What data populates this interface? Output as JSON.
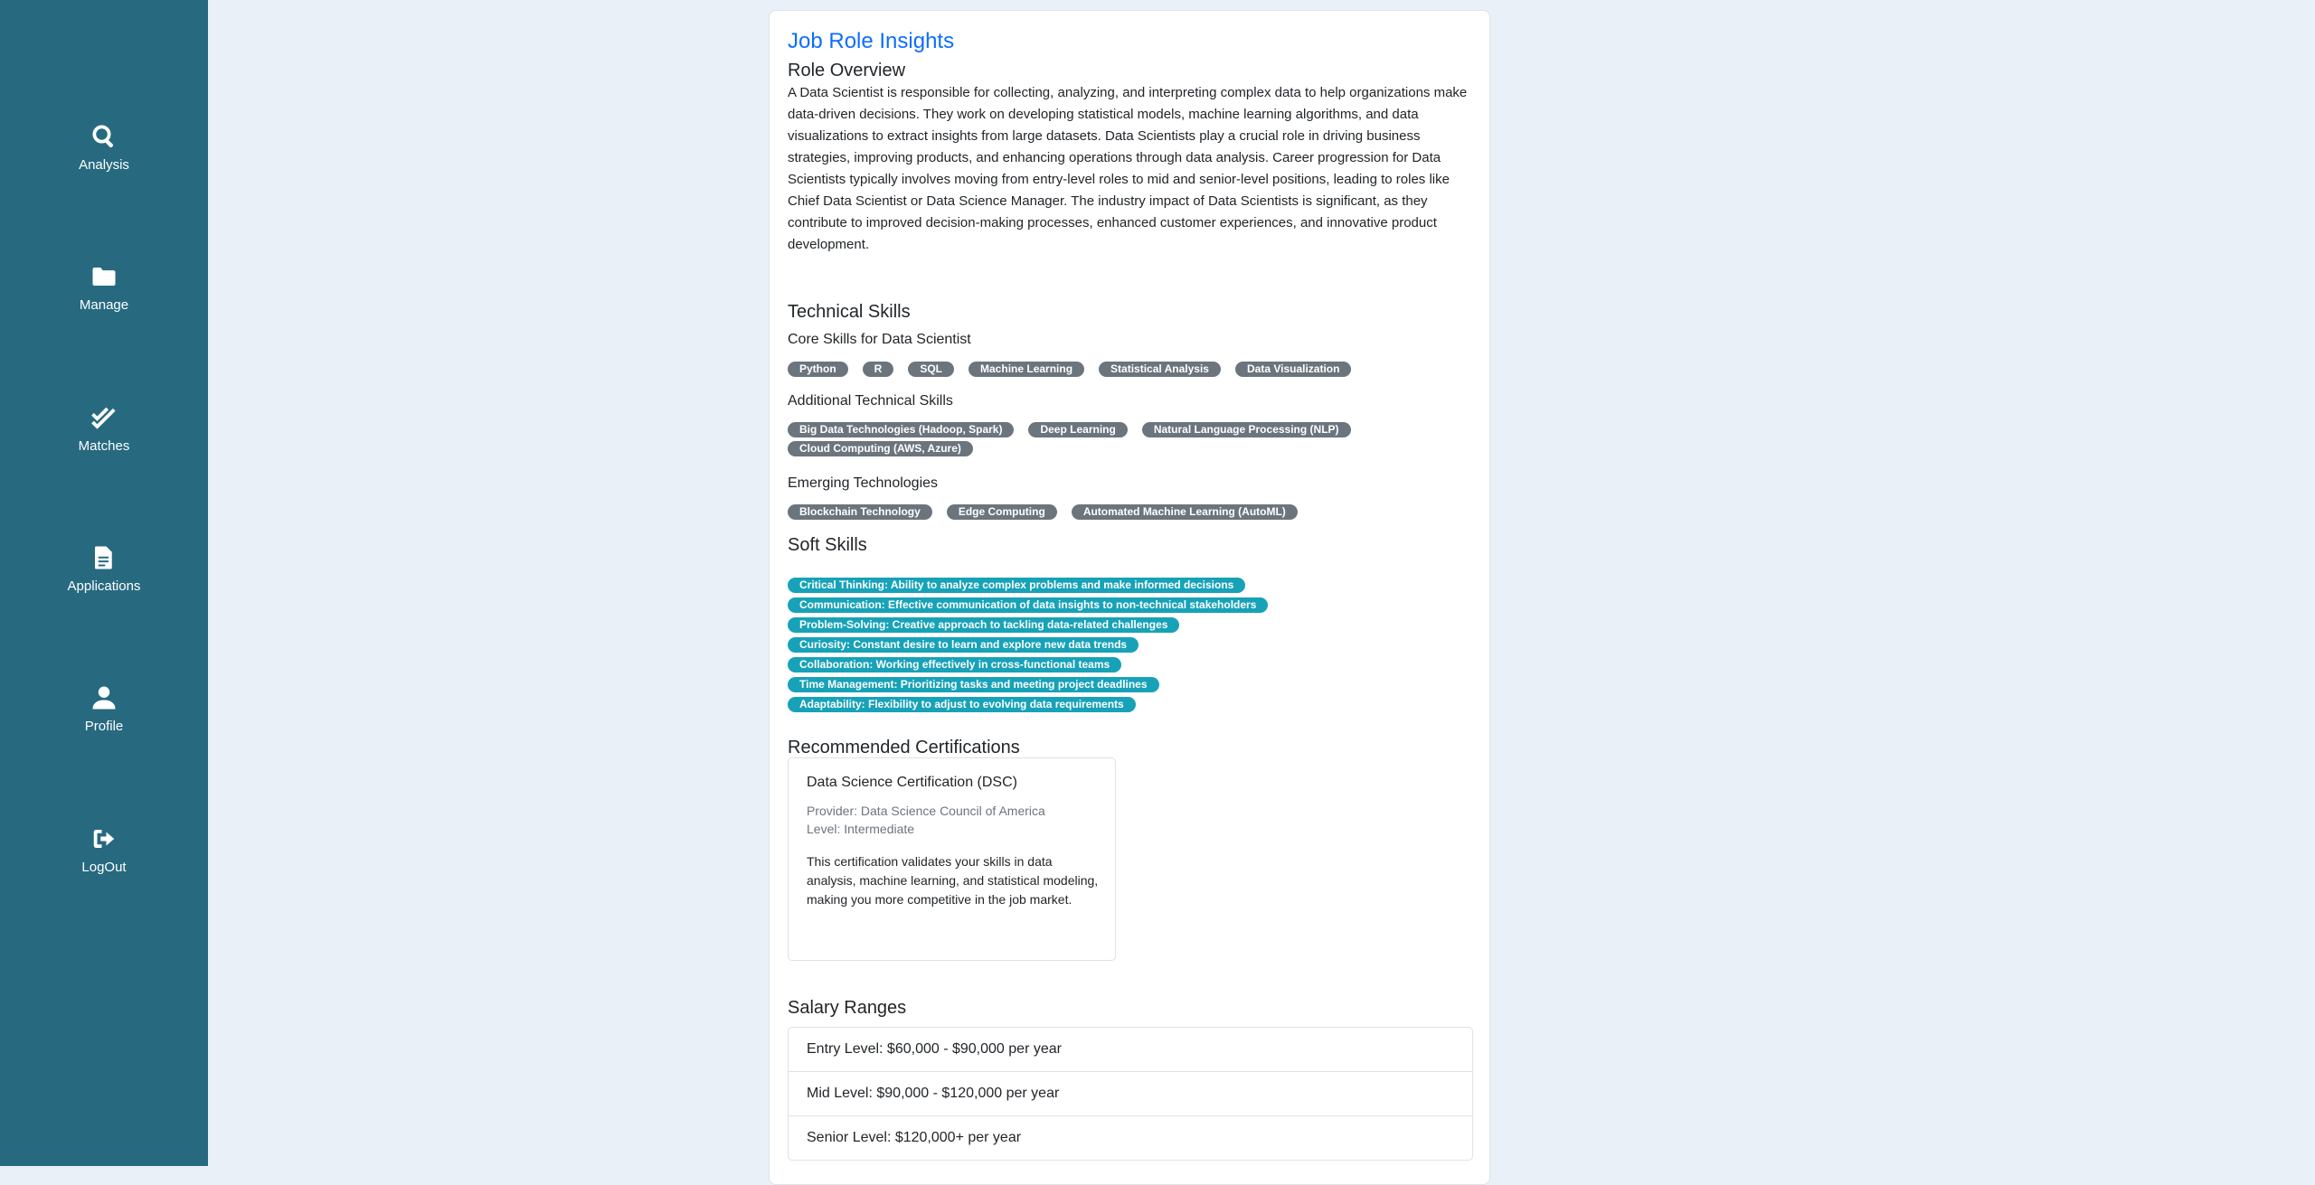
{
  "sidebar": {
    "items": [
      {
        "label": "Analysis",
        "icon": "search-icon"
      },
      {
        "label": "Manage",
        "icon": "folder-icon"
      },
      {
        "label": "Matches",
        "icon": "double-check-icon"
      },
      {
        "label": "Applications",
        "icon": "document-icon"
      },
      {
        "label": "Profile",
        "icon": "user-icon"
      },
      {
        "label": "LogOut",
        "icon": "logout-icon"
      }
    ]
  },
  "main": {
    "title": "Job Role Insights",
    "overview": {
      "heading": "Role Overview",
      "text": "A Data Scientist is responsible for collecting, analyzing, and interpreting complex data to help organizations make data-driven decisions. They work on developing statistical models, machine learning algorithms, and data visualizations to extract insights from large datasets. Data Scientists play a crucial role in driving business strategies, improving products, and enhancing operations through data analysis. Career progression for Data Scientists typically involves moving from entry-level roles to mid and senior-level positions, leading to roles like Chief Data Scientist or Data Science Manager. The industry impact of Data Scientists is significant, as they contribute to improved decision-making processes, enhanced customer experiences, and innovative product development."
    },
    "technical": {
      "heading": "Technical Skills",
      "core_heading": "Core Skills for Data Scientist",
      "core": [
        "Python",
        "R",
        "SQL",
        "Machine Learning",
        "Statistical Analysis",
        "Data Visualization"
      ],
      "additional_heading": "Additional Technical Skills",
      "additional": [
        "Big Data Technologies (Hadoop, Spark)",
        "Deep Learning",
        "Natural Language Processing (NLP)",
        "Cloud Computing (AWS, Azure)"
      ],
      "emerging_heading": "Emerging Technologies",
      "emerging": [
        "Blockchain Technology",
        "Edge Computing",
        "Automated Machine Learning (AutoML)"
      ]
    },
    "soft": {
      "heading": "Soft Skills",
      "items": [
        "Critical Thinking: Ability to analyze complex problems and make informed decisions",
        "Communication: Effective communication of data insights to non-technical stakeholders",
        "Problem-Solving: Creative approach to tackling data-related challenges",
        "Curiosity: Constant desire to learn and explore new data trends",
        "Collaboration: Working effectively in cross-functional teams",
        "Time Management: Prioritizing tasks and meeting project deadlines",
        "Adaptability: Flexibility to adjust to evolving data requirements"
      ]
    },
    "certifications": {
      "heading": "Recommended Certifications",
      "items": [
        {
          "title": "Data Science Certification (DSC)",
          "provider": "Provider: Data Science Council of America",
          "level": "Level: Intermediate",
          "description": "This certification validates your skills in data analysis, machine learning, and statistical modeling, making you more competitive in the job market."
        }
      ]
    },
    "salary": {
      "heading": "Salary Ranges",
      "items": [
        "Entry Level: $60,000 - $90,000 per year",
        "Mid Level: $90,000 - $120,000 per year",
        "Senior Level: $120,000+ per year"
      ]
    }
  }
}
